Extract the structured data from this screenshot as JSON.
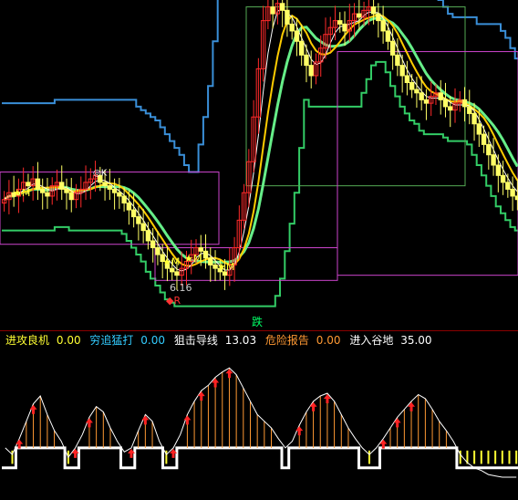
{
  "indicators": [
    {
      "label": "进攻良机",
      "value": "0.00",
      "color": "#ffff33"
    },
    {
      "label": "穷追猛打",
      "value": "0.00",
      "color": "#33ccff"
    },
    {
      "label": "狙击导线",
      "value": "13.03",
      "color": "#ffffff"
    },
    {
      "label": "危险报告",
      "value": "0.00",
      "color": "#ff9933"
    },
    {
      "label": "进入谷地",
      "value": "35.00",
      "color": "#ffffff"
    }
  ],
  "signal_text": "跌",
  "annotation_low": "6.16",
  "annotation_r": "R",
  "markers": {
    "m": "M",
    "k": "K"
  },
  "colors": {
    "background": "#000000",
    "up": "#ff2a2a",
    "down": "#ffff66",
    "ma_fast": "#ffffff",
    "ma_mid": "#ffcc00",
    "curve_green": "#66ee88",
    "upper_band": "#3a8fd8",
    "lower_band": "#33cc66",
    "channel_magenta": "#cc44cc",
    "channel_green": "#55aa55"
  },
  "chart_data": [
    {
      "type": "candlestick",
      "price_range": [
        4.6,
        14.2
      ],
      "close_series": [
        8.4,
        8.6,
        8.5,
        8.7,
        8.9,
        8.8,
        9.0,
        8.7,
        8.6,
        8.5,
        8.8,
        8.9,
        8.7,
        8.6,
        8.4,
        8.6,
        8.7,
        8.9,
        9.0,
        9.1,
        8.9,
        8.8,
        8.7,
        8.6,
        8.5,
        8.3,
        8.1,
        7.9,
        7.7,
        7.5,
        7.2,
        7.0,
        6.8,
        6.6,
        6.4,
        6.3,
        6.2,
        6.4,
        6.6,
        6.8,
        7.0,
        6.9,
        6.7,
        6.5,
        6.4,
        6.3,
        6.2,
        6.5,
        7.0,
        7.8,
        8.6,
        9.5,
        10.8,
        12.2,
        13.6,
        14.0,
        13.8,
        14.1,
        13.9,
        13.5,
        13.3,
        13.0,
        12.6,
        12.3,
        12.0,
        12.4,
        12.8,
        13.2,
        13.4,
        13.6,
        13.5,
        13.3,
        13.6,
        13.8,
        13.7,
        13.9,
        14.0,
        13.8,
        13.6,
        13.3,
        13.0,
        12.6,
        12.3,
        12.0,
        11.8,
        11.6,
        11.5,
        11.3,
        11.2,
        11.4,
        11.5,
        11.3,
        11.1,
        11.0,
        11.2,
        11.3,
        11.1,
        10.9,
        10.6,
        10.3,
        10.0,
        9.7,
        9.4,
        9.1,
        8.9,
        8.7,
        8.5,
        8.4
      ]
    },
    {
      "type": "line",
      "series_name": "狙击导线",
      "value_range": [
        0,
        100
      ],
      "values": [
        35,
        30,
        42,
        55,
        68,
        74,
        60,
        48,
        40,
        28,
        35,
        45,
        58,
        66,
        62,
        50,
        40,
        32,
        35,
        48,
        60,
        55,
        40,
        30,
        35,
        45,
        60,
        70,
        78,
        82,
        88,
        92,
        95,
        90,
        80,
        70,
        60,
        55,
        50,
        42,
        35,
        40,
        52,
        62,
        70,
        74,
        76,
        70,
        60,
        50,
        42,
        35,
        30,
        35,
        42,
        50,
        58,
        64,
        70,
        75,
        72,
        64,
        55,
        48,
        40,
        30,
        24,
        20,
        18,
        15,
        14,
        13,
        13,
        13
      ]
    }
  ]
}
